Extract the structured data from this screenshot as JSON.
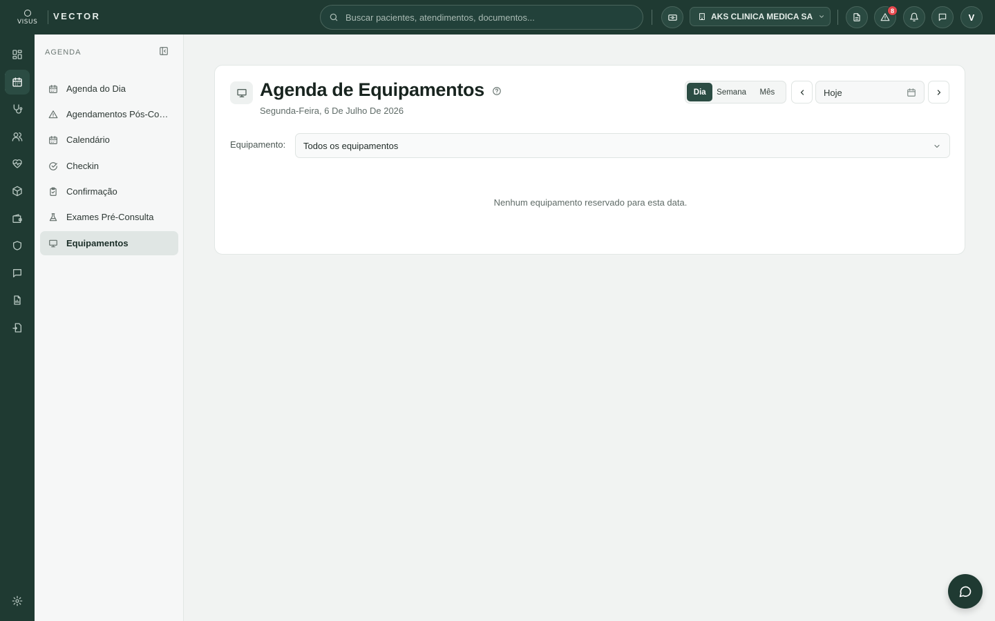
{
  "app": {
    "logo_text": "VISUS",
    "brand": "VECTOR"
  },
  "header": {
    "search_placeholder": "Buscar pacientes, atendimentos, documentos...",
    "clinic_name": "AKS CLINICA MEDICA SA",
    "alerts_count": "8",
    "user_initial": "V"
  },
  "rail": {
    "items": [
      "dashboard-icon",
      "calendar-icon",
      "stethoscope-icon",
      "users-icon",
      "heart-pulse-icon",
      "package-icon",
      "wallet-icon",
      "shield-icon",
      "message-icon",
      "report-icon",
      "document-transfer-icon",
      "settings-icon"
    ],
    "active": "calendar-icon"
  },
  "sidebar": {
    "title": "AGENDA",
    "items": [
      {
        "label": "Agenda do Dia",
        "icon": "calendar-icon"
      },
      {
        "label": "Agendamentos Pós-Consulta",
        "icon": "alert-triangle-icon"
      },
      {
        "label": "Calendário",
        "icon": "calendar-icon"
      },
      {
        "label": "Checkin",
        "icon": "check-circle-icon"
      },
      {
        "label": "Confirmação",
        "icon": "clipboard-check-icon"
      },
      {
        "label": "Exames Pré-Consulta",
        "icon": "flask-icon"
      },
      {
        "label": "Equipamentos",
        "icon": "monitor-icon",
        "active": true
      }
    ]
  },
  "page": {
    "title": "Agenda de Equipamentos",
    "subtitle": "Segunda-Feira, 6 De Julho De 2026",
    "view_modes": [
      "Dia",
      "Semana",
      "Mês"
    ],
    "active_view": "Dia",
    "date_value": "Hoje",
    "equipment_label": "Equipamento:",
    "equipment_selected": "Todos os equipamentos",
    "empty_message": "Nenhum equipamento reservado para esta data."
  },
  "colors": {
    "primary": "#1f3a32",
    "accent": "#2b4c43",
    "badge": "#e5484d"
  }
}
